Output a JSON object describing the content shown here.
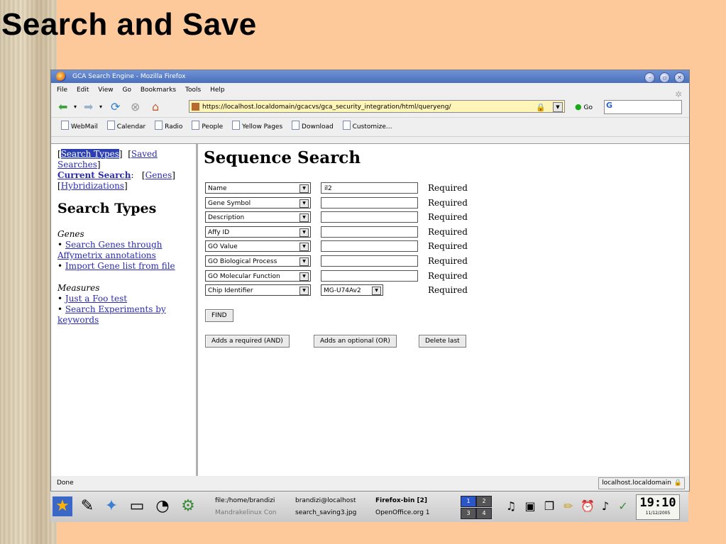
{
  "slide": {
    "title": "Search and Save"
  },
  "window": {
    "title": "GCA Search Engine - Mozilla Firefox",
    "controls": [
      "–",
      "▫",
      "✕"
    ]
  },
  "menus": [
    "File",
    "Edit",
    "View",
    "Go",
    "Bookmarks",
    "Tools",
    "Help"
  ],
  "navbar": {
    "url": "https://localhost.localdomain/gcacvs/gca_security_integration/html/queryeng/",
    "go_label": "Go",
    "search_prefix": "G"
  },
  "bookmarks": [
    "WebMail",
    "Calendar",
    "Radio",
    "People",
    "Yellow Pages",
    "Download",
    "Customize..."
  ],
  "sidebar": {
    "search_types_link": "Search Types",
    "saved_searches_link": "Saved Searches",
    "current_search": "Current Search",
    "genes_link": "Genes",
    "hybridizations_link": "Hybridizations",
    "heading": "Search Types",
    "genes_section": "Genes",
    "genes_items": [
      "Search Genes through Affymetrix annotations",
      "Import Gene list from file"
    ],
    "measures_section": "Measures",
    "measures_items": [
      "Just a Foo test",
      "Search Experiments by keywords"
    ]
  },
  "main": {
    "heading": "Sequence Search",
    "rows": [
      {
        "field": "Name",
        "value": "il2",
        "status": "Required"
      },
      {
        "field": "Gene Symbol",
        "value": "",
        "status": "Required"
      },
      {
        "field": "Description",
        "value": "",
        "status": "Required"
      },
      {
        "field": "Affy ID",
        "value": "",
        "status": "Required"
      },
      {
        "field": "GO Value",
        "value": "",
        "status": "Required"
      },
      {
        "field": "GO Biological Process",
        "value": "",
        "status": "Required"
      },
      {
        "field": "GO Molecular Function",
        "value": "",
        "status": "Required"
      },
      {
        "field": "Chip Identifier",
        "value": "MG-U74Av2",
        "status": "Required"
      }
    ],
    "find_button": "FIND",
    "add_required_button": "Adds a required (AND)",
    "add_optional_button": "Adds an optional (OR)",
    "delete_last_button": "Delete last"
  },
  "status": {
    "left": "Done",
    "right": "localhost.localdomain"
  },
  "taskbar": {
    "tasks": [
      "file:/home/brandizi",
      "Mandrakelinux Con",
      "brandizi@localhost",
      "search_saving3.jpg",
      "Firefox-bin [2]",
      "OpenOffice.org 1"
    ],
    "pager": [
      "1",
      "2",
      "3",
      "4"
    ],
    "clock_time": "19:10",
    "clock_date": "11/12/2005"
  }
}
